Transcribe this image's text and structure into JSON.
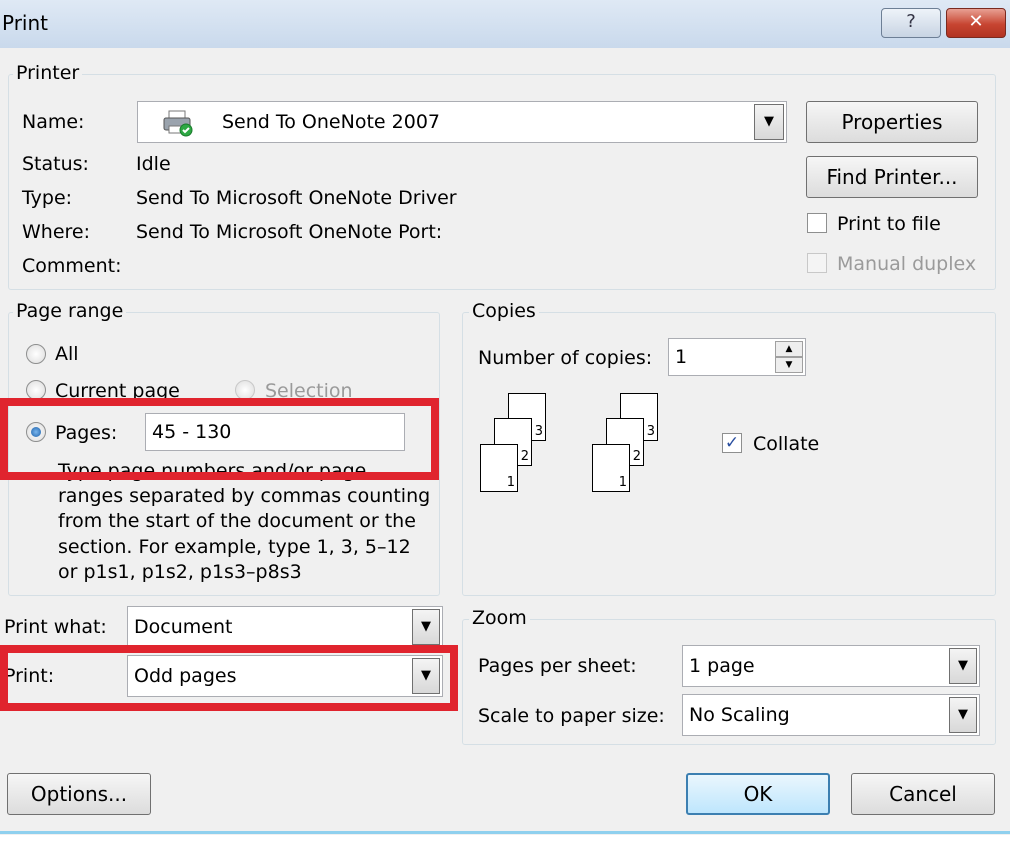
{
  "title": "Print",
  "title_buttons": {
    "help": "?",
    "close": "✕"
  },
  "printer": {
    "legend": "Printer",
    "name_label": "Name:",
    "name_value": "Send To OneNote 2007",
    "status_label": "Status:",
    "status_value": "Idle",
    "type_label": "Type:",
    "type_value": "Send To Microsoft OneNote Driver",
    "where_label": "Where:",
    "where_value": "Send To Microsoft OneNote Port:",
    "comment_label": "Comment:",
    "properties_button": "Properties",
    "find_printer_button": "Find Printer...",
    "print_to_file": "Print to file",
    "manual_duplex": "Manual duplex"
  },
  "page_range": {
    "legend": "Page range",
    "all": "All",
    "current_page": "Current page",
    "selection": "Selection",
    "pages": "Pages:",
    "pages_value": "45 - 130",
    "help_lines": [
      "Type page numbers and/or page",
      "ranges separated by commas counting",
      "from the start of the document or the",
      "section. For example, type 1, 3, 5–12",
      "or p1s1, p1s2, p1s3–p8s3"
    ]
  },
  "copies": {
    "legend": "Copies",
    "number_label": "Number of copies:",
    "number_value": "1",
    "collate": "Collate",
    "collate_checked": true,
    "page_numbers": [
      "1",
      "2",
      "3"
    ]
  },
  "print_what": {
    "label": "Print what:",
    "value": "Document"
  },
  "print_subset": {
    "label": "Print:",
    "value": "Odd pages"
  },
  "zoom": {
    "legend": "Zoom",
    "pages_per_sheet_label": "Pages per sheet:",
    "pages_per_sheet_value": "1 page",
    "scale_label": "Scale to paper size:",
    "scale_value": "No Scaling"
  },
  "buttons": {
    "options": "Options...",
    "ok": "OK",
    "cancel": "Cancel"
  },
  "colors": {
    "highlight": "#e0242e",
    "titlebar": "#c9d9ec"
  },
  "icons": [
    "printer-icon",
    "question-icon",
    "close-icon",
    "dropdown-arrow-icon",
    "spinner-up-icon",
    "spinner-down-icon",
    "collate-pages-icon"
  ]
}
